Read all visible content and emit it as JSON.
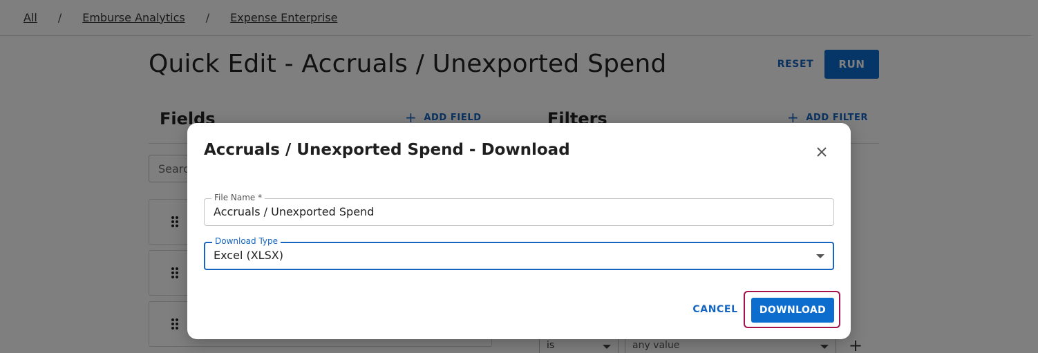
{
  "breadcrumb": {
    "items": [
      "All",
      "Emburse Analytics",
      "Expense Enterprise"
    ],
    "separator": "/"
  },
  "page": {
    "title": "Quick Edit - Accruals / Unexported Spend",
    "reset_label": "RESET",
    "run_label": "RUN"
  },
  "fields_panel": {
    "heading": "Fields",
    "add_label": "ADD FIELD",
    "search_placeholder": "Search"
  },
  "filters_panel": {
    "heading": "Filters",
    "add_label": "ADD FILTER",
    "operator": "is",
    "value": "any value"
  },
  "dialog": {
    "title": "Accruals / Unexported Spend - Download",
    "file_name": {
      "label": "File Name *",
      "value": "Accruals / Unexported Spend"
    },
    "download_type": {
      "label": "Download Type",
      "value": "Excel (XLSX)"
    },
    "cancel_label": "CANCEL",
    "download_label": "DOWNLOAD"
  },
  "colors": {
    "primary": "#0d6dcf",
    "link": "#1565c0",
    "highlight": "#a3124a",
    "overlay": "rgba(0,0,0,0.5)"
  },
  "icons": [
    "plus-icon",
    "drag-handle-icon",
    "close-icon",
    "chevron-down-icon"
  ]
}
